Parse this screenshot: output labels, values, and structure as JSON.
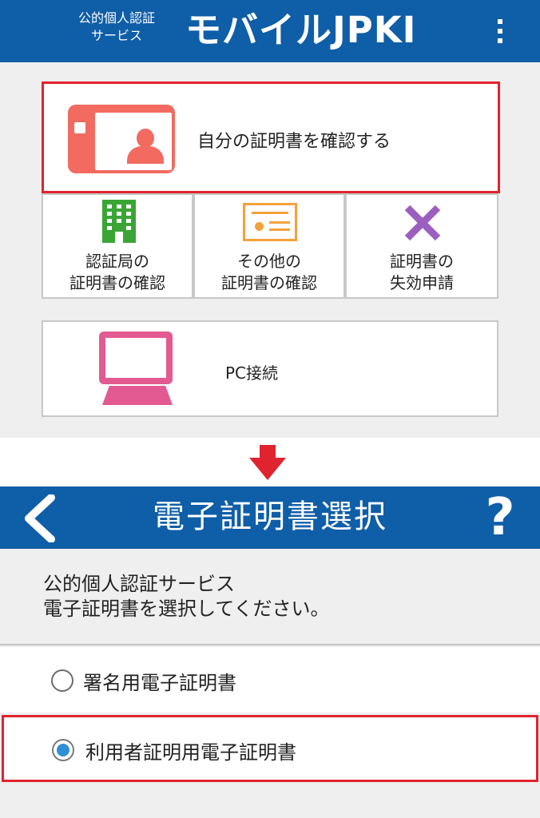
{
  "top_header": {
    "service_line1": "公的個人認証",
    "service_line2": "サービス",
    "app_name": "モバイルJPKI",
    "bg_color": "#0f5ea8"
  },
  "menu": {
    "primary": {
      "label": "自分の証明書を確認する",
      "icon": "id-card-icon"
    },
    "items": [
      {
        "line1": "認証局の",
        "line2": "証明書の確認",
        "icon": "building-icon"
      },
      {
        "line1": "その他の",
        "line2": "証明書の確認",
        "icon": "certificate-icon"
      },
      {
        "line1": "証明書の",
        "line2": "失効申請",
        "icon": "revoke-x-icon"
      }
    ],
    "pc": {
      "label": "PC接続",
      "icon": "laptop-icon"
    }
  },
  "select_screen": {
    "title": "電子証明書選択",
    "back_icon": "chevron-left-icon",
    "help_label": "?",
    "instruction_line1": "公的個人認証サービス",
    "instruction_line2": "電子証明書を選択してください。",
    "options": [
      {
        "label": "署名用電子証明書",
        "selected": false
      },
      {
        "label": "利用者証明用電子証明書",
        "selected": true
      }
    ]
  },
  "colors": {
    "highlight": "#e0242f",
    "id_card": "#f26a60",
    "building": "#3aa535",
    "certificate": "#f4a13a",
    "revoke": "#9b5fc0",
    "laptop": "#e35a92",
    "radio_selected": "#2f8fd6"
  }
}
